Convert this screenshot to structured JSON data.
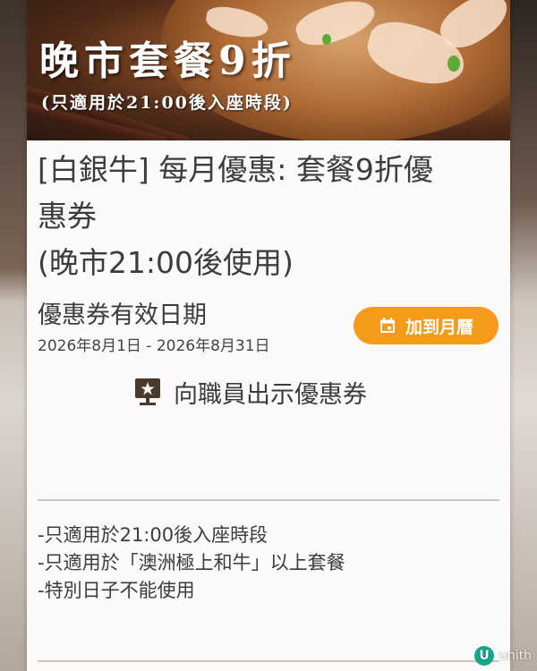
{
  "hero": {
    "title": "晚市套餐9折",
    "subtitle": "(只適用於21:00後入座時段)"
  },
  "coupon": {
    "title_lines": [
      "[白銀牛] 每月優惠: 套餐9折優",
      "惠券",
      "(晚市21:00後使用)"
    ],
    "validity_label": "優惠券有效日期",
    "validity_dates": "2026年8月1日 - 2026年8月31日",
    "calendar_button_label": "加到月曆",
    "show_staff_label": "向職員出示優惠券"
  },
  "terms": [
    "-只適用於21:00後入座時段",
    "-只適用於「澳洲極上和牛」以上套餐",
    "-特別日子不能使用"
  ],
  "watermark": {
    "logo_letter": "U",
    "text": "unith"
  },
  "colors": {
    "accent": "#f59a19",
    "text": "#3c3c3c",
    "card_background": "#fbfaf9",
    "divider": "#c9c4bf"
  },
  "icons": {
    "calendar_button": "calendar-icon",
    "show_staff": "staff-display-icon"
  }
}
